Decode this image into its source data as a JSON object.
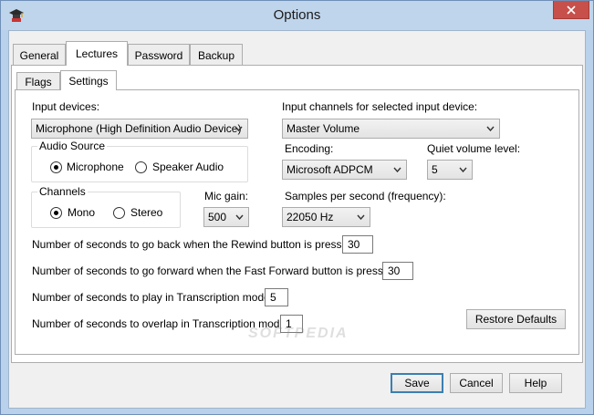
{
  "window": {
    "title": "Options",
    "close_symbol": "✕"
  },
  "tabs": [
    {
      "label": "General"
    },
    {
      "label": "Lectures"
    },
    {
      "label": "Password"
    },
    {
      "label": "Backup"
    }
  ],
  "subtabs": [
    {
      "label": "Flags"
    },
    {
      "label": "Settings"
    }
  ],
  "settings": {
    "input_devices_label": "Input devices:",
    "input_device_value": "Microphone (High Definition Audio Device)",
    "input_channels_label": "Input channels for selected input device:",
    "input_channel_value": "Master Volume",
    "audio_source_title": "Audio Source",
    "audio_source_options": [
      "Microphone",
      "Speaker Audio"
    ],
    "encoding_label": "Encoding:",
    "encoding_value": "Microsoft ADPCM",
    "quiet_volume_label": "Quiet volume level:",
    "quiet_volume_value": "5",
    "channels_title": "Channels",
    "channels_options": [
      "Mono",
      "Stereo"
    ],
    "mic_gain_label": "Mic gain:",
    "mic_gain_value": "500",
    "samples_label": "Samples per second (frequency):",
    "samples_value": "22050 Hz",
    "rewind_label": "Number of seconds to go back when the Rewind button is pressed:",
    "rewind_value": "30",
    "ff_label": "Number of seconds to go forward when the Fast Forward button is pressed:",
    "ff_value": "30",
    "play_label": "Number of seconds to play in Transcription mode:",
    "play_value": "5",
    "overlap_label": "Number of seconds to overlap in Transcription mode:",
    "overlap_value": "1",
    "restore_label": "Restore Defaults"
  },
  "footer": {
    "save_label": "Save",
    "cancel_label": "Cancel",
    "help_label": "Help"
  },
  "watermark": "SOFTPEDIA",
  "colors": {
    "titlebar": "#bfd5ec",
    "close": "#c7504b",
    "default_button_border": "#3c7fb1"
  }
}
